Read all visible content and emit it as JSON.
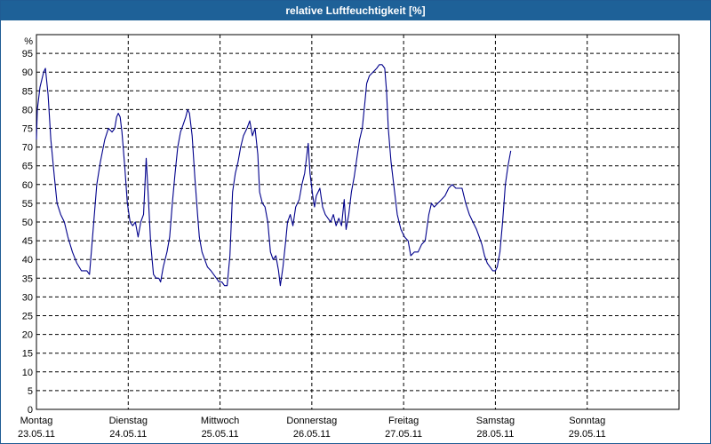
{
  "window": {
    "title": "relative Luftfeuchtigkeit [%]"
  },
  "chart_data": {
    "type": "line",
    "title": "relative Luftfeuchtigkeit [%]",
    "ylabel": "%",
    "xlabel": "",
    "ylim": [
      0,
      100
    ],
    "yticks": [
      0,
      5,
      10,
      15,
      20,
      25,
      30,
      35,
      40,
      45,
      50,
      55,
      60,
      65,
      70,
      75,
      80,
      85,
      90,
      95
    ],
    "x_range_days": [
      0,
      7
    ],
    "grid": true,
    "days": [
      {
        "weekday": "Montag",
        "date": "23.05.11"
      },
      {
        "weekday": "Dienstag",
        "date": "24.05.11"
      },
      {
        "weekday": "Mittwoch",
        "date": "25.05.11"
      },
      {
        "weekday": "Donnerstag",
        "date": "26.05.11"
      },
      {
        "weekday": "Freitag",
        "date": "27.05.11"
      },
      {
        "weekday": "Samstag",
        "date": "28.05.11"
      },
      {
        "weekday": "Sonntag",
        "date": "29.05.11"
      }
    ],
    "series": [
      {
        "color": "#00008b",
        "points": [
          [
            0.0,
            72
          ],
          [
            0.01,
            80
          ],
          [
            0.039,
            86
          ],
          [
            0.078,
            90
          ],
          [
            0.098,
            91
          ],
          [
            0.127,
            84
          ],
          [
            0.157,
            72
          ],
          [
            0.196,
            62
          ],
          [
            0.225,
            55
          ],
          [
            0.264,
            52
          ],
          [
            0.304,
            50
          ],
          [
            0.343,
            46
          ],
          [
            0.392,
            42
          ],
          [
            0.441,
            39
          ],
          [
            0.49,
            37
          ],
          [
            0.549,
            37
          ],
          [
            0.578,
            36
          ],
          [
            0.608,
            45
          ],
          [
            0.657,
            60
          ],
          [
            0.696,
            66
          ],
          [
            0.745,
            72
          ],
          [
            0.784,
            75
          ],
          [
            0.824,
            74
          ],
          [
            0.853,
            75
          ],
          [
            0.873,
            78
          ],
          [
            0.892,
            79
          ],
          [
            0.912,
            78
          ],
          [
            0.931,
            74
          ],
          [
            0.961,
            65
          ],
          [
            0.99,
            55
          ],
          [
            1.02,
            50
          ],
          [
            1.049,
            49
          ],
          [
            1.078,
            50
          ],
          [
            1.108,
            46
          ],
          [
            1.137,
            50
          ],
          [
            1.167,
            52
          ],
          [
            1.196,
            67
          ],
          [
            1.216,
            58
          ],
          [
            1.245,
            44
          ],
          [
            1.275,
            36
          ],
          [
            1.304,
            35
          ],
          [
            1.333,
            35
          ],
          [
            1.353,
            34
          ],
          [
            1.382,
            38
          ],
          [
            1.422,
            42
          ],
          [
            1.451,
            46
          ],
          [
            1.48,
            55
          ],
          [
            1.51,
            63
          ],
          [
            1.539,
            70
          ],
          [
            1.569,
            74
          ],
          [
            1.598,
            76
          ],
          [
            1.627,
            78
          ],
          [
            1.647,
            80
          ],
          [
            1.667,
            79
          ],
          [
            1.696,
            73
          ],
          [
            1.725,
            62
          ],
          [
            1.755,
            52
          ],
          [
            1.775,
            46
          ],
          [
            1.804,
            42
          ],
          [
            1.833,
            40
          ],
          [
            1.863,
            38
          ],
          [
            1.902,
            37
          ],
          [
            1.931,
            36
          ],
          [
            1.961,
            35
          ],
          [
            1.99,
            34
          ],
          [
            2.02,
            34
          ],
          [
            2.049,
            33
          ],
          [
            2.078,
            33
          ],
          [
            2.108,
            41
          ],
          [
            2.137,
            58
          ],
          [
            2.167,
            63
          ],
          [
            2.196,
            66
          ],
          [
            2.225,
            70
          ],
          [
            2.255,
            73
          ],
          [
            2.294,
            75
          ],
          [
            2.324,
            77
          ],
          [
            2.353,
            73
          ],
          [
            2.382,
            75
          ],
          [
            2.412,
            68
          ],
          [
            2.431,
            58
          ],
          [
            2.461,
            55
          ],
          [
            2.49,
            54
          ],
          [
            2.52,
            50
          ],
          [
            2.549,
            42
          ],
          [
            2.578,
            40
          ],
          [
            2.608,
            41
          ],
          [
            2.637,
            37
          ],
          [
            2.657,
            33
          ],
          [
            2.686,
            38
          ],
          [
            2.716,
            45
          ],
          [
            2.735,
            50
          ],
          [
            2.765,
            52
          ],
          [
            2.794,
            49
          ],
          [
            2.824,
            54
          ],
          [
            2.863,
            56
          ],
          [
            2.892,
            60
          ],
          [
            2.922,
            63
          ],
          [
            2.941,
            67
          ],
          [
            2.961,
            71
          ],
          [
            2.98,
            63
          ],
          [
            3.01,
            57
          ],
          [
            3.029,
            54
          ],
          [
            3.049,
            57
          ],
          [
            3.088,
            59
          ],
          [
            3.118,
            54
          ],
          [
            3.147,
            52
          ],
          [
            3.176,
            51
          ],
          [
            3.206,
            50
          ],
          [
            3.235,
            52
          ],
          [
            3.265,
            49
          ],
          [
            3.294,
            51
          ],
          [
            3.324,
            49
          ],
          [
            3.353,
            56
          ],
          [
            3.373,
            48
          ],
          [
            3.402,
            52
          ],
          [
            3.431,
            58
          ],
          [
            3.461,
            62
          ],
          [
            3.49,
            67
          ],
          [
            3.52,
            72
          ],
          [
            3.549,
            75
          ],
          [
            3.578,
            82
          ],
          [
            3.598,
            87
          ],
          [
            3.627,
            89
          ],
          [
            3.667,
            90
          ],
          [
            3.706,
            91
          ],
          [
            3.735,
            92
          ],
          [
            3.765,
            92
          ],
          [
            3.794,
            91
          ],
          [
            3.814,
            85
          ],
          [
            3.833,
            75
          ],
          [
            3.863,
            66
          ],
          [
            3.892,
            60
          ],
          [
            3.931,
            52
          ],
          [
            3.971,
            48
          ],
          [
            4.01,
            46
          ],
          [
            4.049,
            45
          ],
          [
            4.078,
            41
          ],
          [
            4.118,
            42
          ],
          [
            4.157,
            42
          ],
          [
            4.196,
            44
          ],
          [
            4.235,
            45
          ],
          [
            4.275,
            52
          ],
          [
            4.304,
            55
          ],
          [
            4.333,
            54
          ],
          [
            4.373,
            55
          ],
          [
            4.412,
            56
          ],
          [
            4.451,
            57
          ],
          [
            4.49,
            59
          ],
          [
            4.529,
            60
          ],
          [
            4.569,
            59
          ],
          [
            4.608,
            59
          ],
          [
            4.637,
            59
          ],
          [
            4.676,
            55
          ],
          [
            4.716,
            52
          ],
          [
            4.755,
            50
          ],
          [
            4.794,
            48
          ],
          [
            4.824,
            46
          ],
          [
            4.853,
            44
          ],
          [
            4.882,
            41
          ],
          [
            4.912,
            39
          ],
          [
            4.941,
            38
          ],
          [
            4.971,
            37
          ],
          [
            5.0,
            37
          ],
          [
            5.02,
            38
          ],
          [
            5.049,
            42
          ],
          [
            5.078,
            50
          ],
          [
            5.108,
            60
          ],
          [
            5.137,
            65
          ],
          [
            5.167,
            69
          ]
        ]
      }
    ]
  }
}
